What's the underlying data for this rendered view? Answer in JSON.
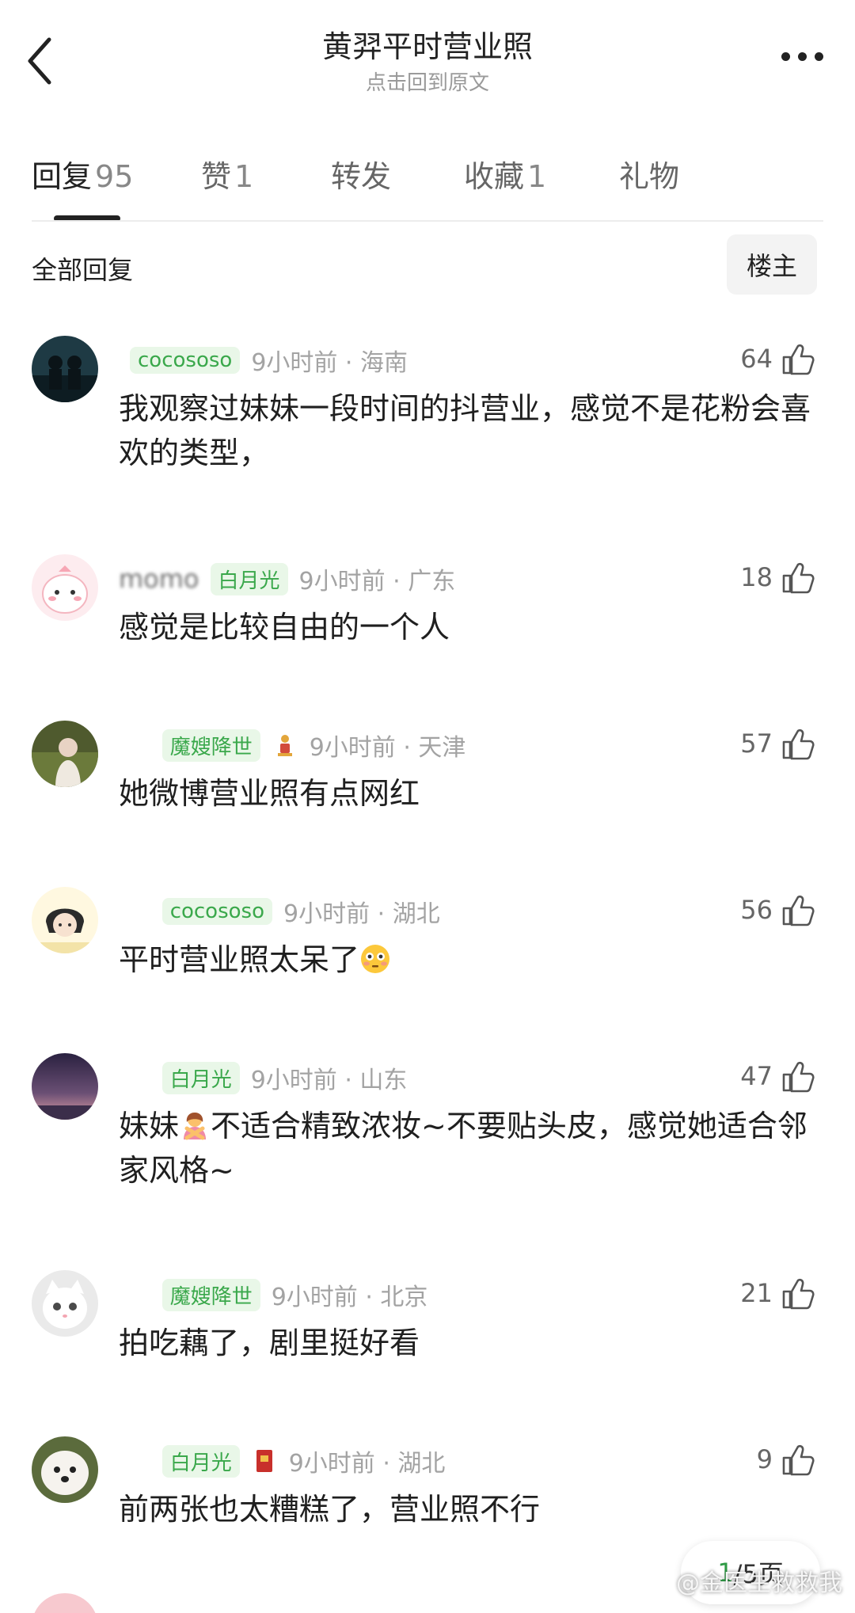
{
  "header": {
    "title": "黄羿平时营业照",
    "subtitle": "点击回到原文"
  },
  "tabs": [
    {
      "label": "回复",
      "count": "95"
    },
    {
      "label": "赞",
      "count": "1"
    },
    {
      "label": "转发",
      "count": ""
    },
    {
      "label": "收藏",
      "count": "1"
    },
    {
      "label": "礼物",
      "count": ""
    }
  ],
  "filter": {
    "all_replies": "全部回复",
    "op_button": "楼主"
  },
  "comments": [
    {
      "username": "",
      "badge": "cocososo",
      "time": "9小时前 · 海南",
      "likes": "64",
      "text": "我观察过妹妹一段时间的抖营业，感觉不是花粉会喜欢的类型，",
      "avatar_icon": "dark-silhouette-avatar"
    },
    {
      "username": "momo",
      "badge": "白月光",
      "time": "9小时前 · 广东",
      "likes": "18",
      "text": "感觉是比较自由的一个人",
      "avatar_icon": "pink-cartoon-avatar"
    },
    {
      "username": "",
      "badge": "魔嫂降世",
      "time": "9小时前 · 天津",
      "likes": "57",
      "text": "她微博营业照有点网红",
      "avatar_icon": "girl-photo-avatar"
    },
    {
      "username": "",
      "badge": "cocososo",
      "time": "9小时前 · 湖北",
      "likes": "56",
      "text_before": "平时营业照太呆了",
      "emoji": "flushed-face-emoji",
      "avatar_icon": "anime-girl-avatar"
    },
    {
      "username": "",
      "badge": "白月光",
      "time": "9小时前 · 山东",
      "likes": "47",
      "text_before": "妹妹",
      "emoji": "person-gesturing-no-emoji",
      "text_after": "不适合精致浓妆~不要贴头皮，感觉她适合邻家风格~",
      "avatar_icon": "dusk-sky-avatar"
    },
    {
      "username": "",
      "badge": "魔嫂降世",
      "time": "9小时前 · 北京",
      "likes": "21",
      "text": "拍吃藕了，剧里挺好看",
      "avatar_icon": "white-cat-avatar"
    },
    {
      "username": "",
      "badge": "白月光",
      "time": "9小时前 · 湖北",
      "likes": "9",
      "text": "前两张也太糟糕了，营业照不行",
      "avatar_icon": "white-dog-avatar"
    }
  ],
  "pagination": {
    "current": "1",
    "total": "/5页"
  },
  "watermark": "@金医生救救我",
  "colors": {
    "badge_green": "#3aa84b",
    "badge_bg": "#e9f7e8",
    "page_green": "#2f9b45"
  }
}
